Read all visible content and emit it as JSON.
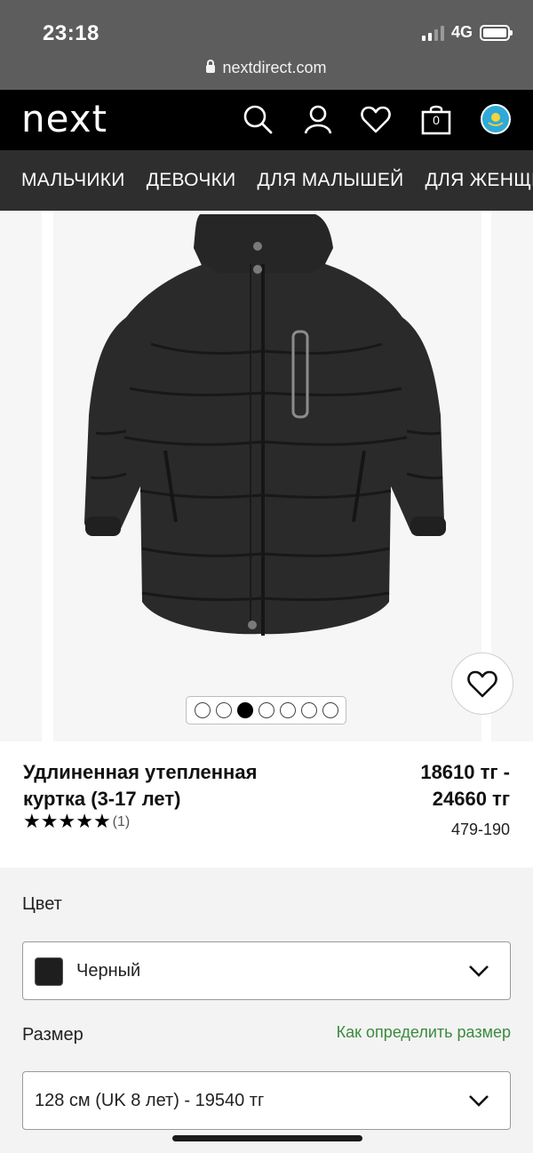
{
  "status": {
    "time": "23:18",
    "network": "4G",
    "url": "nextdirect.com"
  },
  "header": {
    "logo": "next",
    "bag_count": "0",
    "icons": [
      "search-icon",
      "account-icon",
      "wishlist-icon",
      "bag-icon",
      "country-flag-icon"
    ]
  },
  "nav": {
    "items": [
      "МАЛЬЧИКИ",
      "ДЕВОЧКИ",
      "ДЛЯ МАЛЫШЕЙ",
      "ДЛЯ ЖЕНЩИН"
    ]
  },
  "gallery": {
    "image_count": 7,
    "active_index": 2
  },
  "product": {
    "name": "Удлиненная утепленная куртка (3-17 лет)",
    "price": "18610 тг - 24660 тг",
    "rating_stars": 5,
    "review_count": "(1)",
    "sku": "479-190"
  },
  "options": {
    "color_label": "Цвет",
    "color_value": "Черный",
    "size_label": "Размер",
    "size_guide": "Как определить размер",
    "size_value": "128 см (UK 8 лет) - 19540 тг"
  },
  "colors": {
    "header_bg": "#000000",
    "nav_bg": "#2e2e2e",
    "accent_green": "#3b8a3e",
    "swatch": "#1e1e1e"
  }
}
